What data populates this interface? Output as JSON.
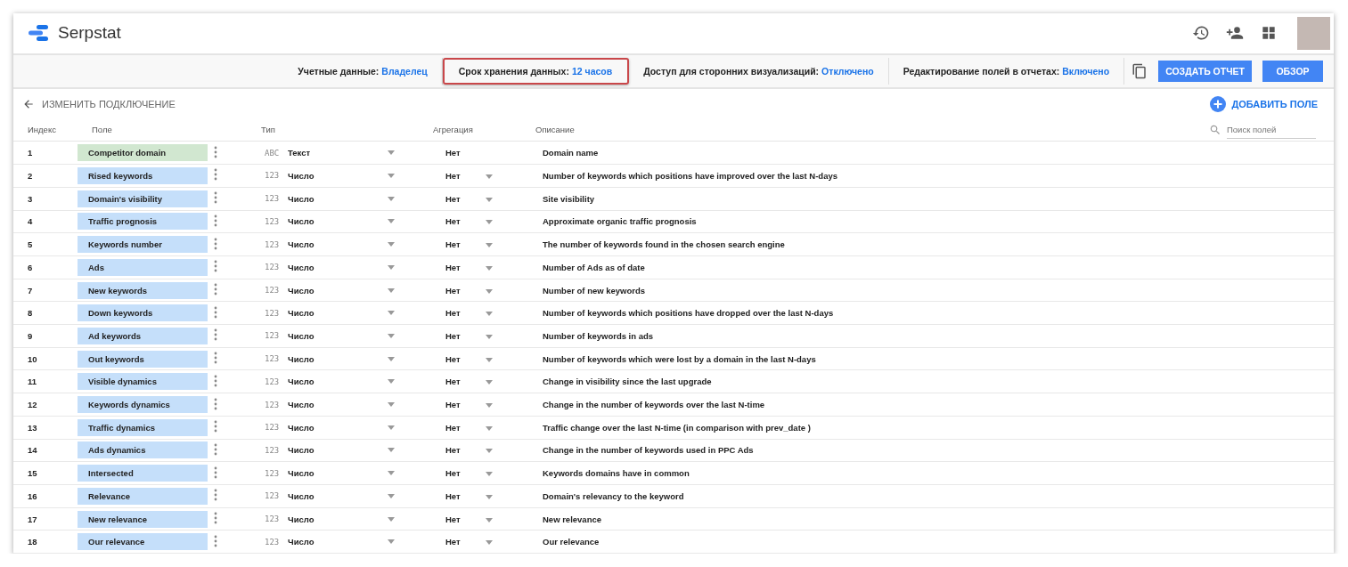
{
  "header": {
    "brand": "Serpstat"
  },
  "settings": [
    {
      "label": "Учетные данные:",
      "value": "Владелец",
      "highlighted": false
    },
    {
      "label": "Срок хранения данных:",
      "value": "12 часов",
      "highlighted": true
    },
    {
      "label": "Доступ для сторонних визуализаций:",
      "value": "Отключено",
      "highlighted": false
    },
    {
      "label": "Редактирование полей в отчетах:",
      "value": "Включено",
      "highlighted": false
    }
  ],
  "buttons": {
    "create": "СОЗДАТЬ ОТЧЕТ",
    "overview": "ОБЗОР"
  },
  "back_link": "ИЗМЕНИТЬ ПОДКЛЮЧЕНИЕ",
  "add_field": "ДОБАВИТЬ ПОЛЕ",
  "search": {
    "placeholder": "Поиск полей"
  },
  "columns": [
    "Индекс",
    "Поле",
    "Тип",
    "Агрегация",
    "Описание"
  ],
  "rows": [
    {
      "index": "1",
      "field": "Competitor domain",
      "kind": "dimension",
      "type_icon": "ABC",
      "type": "Текст",
      "aggregation": "Нет",
      "description": "Domain name"
    },
    {
      "index": "2",
      "field": "Rised keywords",
      "kind": "metric",
      "type_icon": "123",
      "type": "Число",
      "aggregation": "Нет",
      "description": "Number of keywords which positions have improved over the last N-days"
    },
    {
      "index": "3",
      "field": "Domain's visibility",
      "kind": "metric",
      "type_icon": "123",
      "type": "Число",
      "aggregation": "Нет",
      "description": "Site visibility"
    },
    {
      "index": "4",
      "field": "Traffic prognosis",
      "kind": "metric",
      "type_icon": "123",
      "type": "Число",
      "aggregation": "Нет",
      "description": "Approximate organic traffic prognosis"
    },
    {
      "index": "5",
      "field": "Keywords number",
      "kind": "metric",
      "type_icon": "123",
      "type": "Число",
      "aggregation": "Нет",
      "description": "The number of keywords found in the chosen search engine"
    },
    {
      "index": "6",
      "field": "Ads",
      "kind": "metric",
      "type_icon": "123",
      "type": "Число",
      "aggregation": "Нет",
      "description": "Number of Ads as of date"
    },
    {
      "index": "7",
      "field": "New keywords",
      "kind": "metric",
      "type_icon": "123",
      "type": "Число",
      "aggregation": "Нет",
      "description": "Number of new keywords"
    },
    {
      "index": "8",
      "field": "Down keywords",
      "kind": "metric",
      "type_icon": "123",
      "type": "Число",
      "aggregation": "Нет",
      "description": "Number of keywords which positions have dropped over the last N-days"
    },
    {
      "index": "9",
      "field": "Ad keywords",
      "kind": "metric",
      "type_icon": "123",
      "type": "Число",
      "aggregation": "Нет",
      "description": "Number of keywords in ads"
    },
    {
      "index": "10",
      "field": "Out keywords",
      "kind": "metric",
      "type_icon": "123",
      "type": "Число",
      "aggregation": "Нет",
      "description": "Number of keywords which were lost by a domain in the last N-days"
    },
    {
      "index": "11",
      "field": "Visible dynamics",
      "kind": "metric",
      "type_icon": "123",
      "type": "Число",
      "aggregation": "Нет",
      "description": "Change in visibility since the last upgrade"
    },
    {
      "index": "12",
      "field": "Keywords dynamics",
      "kind": "metric",
      "type_icon": "123",
      "type": "Число",
      "aggregation": "Нет",
      "description": "Change in the number of keywords over the last N-time"
    },
    {
      "index": "13",
      "field": "Traffic dynamics",
      "kind": "metric",
      "type_icon": "123",
      "type": "Число",
      "aggregation": "Нет",
      "description": "Traffic change over the last N-time (in comparison with prev_date )"
    },
    {
      "index": "14",
      "field": "Ads dynamics",
      "kind": "metric",
      "type_icon": "123",
      "type": "Число",
      "aggregation": "Нет",
      "description": "Change in the number of keywords used in PPC Ads"
    },
    {
      "index": "15",
      "field": "Intersected",
      "kind": "metric",
      "type_icon": "123",
      "type": "Число",
      "aggregation": "Нет",
      "description": "Keywords domains have in common"
    },
    {
      "index": "16",
      "field": "Relevance",
      "kind": "metric",
      "type_icon": "123",
      "type": "Число",
      "aggregation": "Нет",
      "description": "Domain's relevancy to the keyword"
    },
    {
      "index": "17",
      "field": "New relevance",
      "kind": "metric",
      "type_icon": "123",
      "type": "Число",
      "aggregation": "Нет",
      "description": "New relevance"
    },
    {
      "index": "18",
      "field": "Our relevance",
      "kind": "metric",
      "type_icon": "123",
      "type": "Число",
      "aggregation": "Нет",
      "description": "Our relevance"
    }
  ]
}
